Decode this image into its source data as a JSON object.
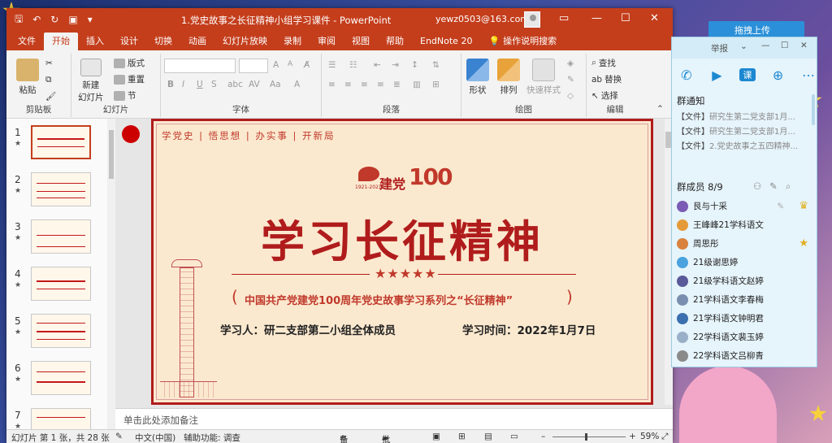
{
  "colors": {
    "ppt_accent": "#c43e1c",
    "slide_red": "#b01c1c",
    "qq_blue": "#1b88d1"
  },
  "window": {
    "title": "1.党史故事之长征精神小组学习课件  -  PowerPoint",
    "user": "yewz0503@163.com",
    "quick_access_icons": [
      "save-icon",
      "undo-icon",
      "redo-icon",
      "slideshow-icon",
      "customize-icon"
    ]
  },
  "tabs": [
    {
      "label": "文件"
    },
    {
      "label": "开始"
    },
    {
      "label": "插入"
    },
    {
      "label": "设计"
    },
    {
      "label": "切换"
    },
    {
      "label": "动画"
    },
    {
      "label": "幻灯片放映"
    },
    {
      "label": "录制"
    },
    {
      "label": "审阅"
    },
    {
      "label": "视图"
    },
    {
      "label": "帮助"
    },
    {
      "label": "EndNote 20"
    },
    {
      "label": "操作说明搜索"
    }
  ],
  "ribbon": {
    "clipboard": {
      "paste": "粘贴",
      "label": "剪贴板"
    },
    "slides": {
      "new_slide": "新建\n幻灯片",
      "layout": "版式",
      "reset": "重置",
      "section": "节",
      "label": "幻灯片"
    },
    "font": {
      "label": "字体",
      "bold": "B",
      "italic": "I",
      "underline": "U",
      "strike": "S",
      "grow": "A",
      "shrink": "A",
      "case": "Aa"
    },
    "paragraph": {
      "label": "段落"
    },
    "drawing": {
      "shapes": "形状",
      "arrange": "排列",
      "quick_styles": "快速样式",
      "label": "绘图"
    },
    "editing": {
      "find": "查找",
      "replace": "替换",
      "select": "选择",
      "label": "编辑"
    }
  },
  "thumbnails": [
    {
      "num": "1",
      "star": "★"
    },
    {
      "num": "2",
      "star": "★"
    },
    {
      "num": "3",
      "star": "★"
    },
    {
      "num": "4",
      "star": "★"
    },
    {
      "num": "5",
      "star": "★"
    },
    {
      "num": "6",
      "star": "★"
    },
    {
      "num": "7",
      "star": "★"
    }
  ],
  "slide": {
    "top_tagline": "学党史 | 悟思想 | 办实事 | 开新局",
    "logo_years": "1921-2021",
    "logo_text": "建党",
    "logo_100": "100",
    "title": "学习长征精神",
    "stars": "★★★★★",
    "subtitle": "中国共产党建党100周年党史故事学习系列之“长征精神”",
    "paren_left": "(",
    "paren_right": ")",
    "learner": "学习人：研二支部第二小组全体成员",
    "time": "学习时间：2022年1月7日"
  },
  "notes_placeholder": "单击此处添加备注",
  "status": {
    "slide_info": "幻灯片 第 1 张，共 28 张",
    "language": "中文(中国)",
    "accessibility": "辅助功能: 调查",
    "notes": "备注",
    "comments": "批注",
    "zoom": "59%"
  },
  "qq": {
    "upload": "拖拽上传",
    "top_label": "举报",
    "notice_title": "群通知",
    "files": [
      {
        "tag": "【文件】",
        "text": "研究生第二党支部1月..."
      },
      {
        "tag": "【文件】",
        "text": "研究生第二党支部1月..."
      },
      {
        "tag": "【文件】",
        "text": "2.党史故事之五四精神..."
      }
    ],
    "members_title": "群成员 8/9",
    "members": [
      {
        "name": "艮与十采",
        "color": "#7a5bb5",
        "badge": "crown"
      },
      {
        "name": "王峰峰21学科语文",
        "color": "#e59a3a",
        "badge": ""
      },
      {
        "name": "周思彤",
        "color": "#d9813e",
        "badge": "star"
      },
      {
        "name": "21级谢思婷",
        "color": "#4aa3df",
        "badge": ""
      },
      {
        "name": "21级学科语文赵婷",
        "color": "#5a5a9a",
        "badge": ""
      },
      {
        "name": "21学科语文李春梅",
        "color": "#7a8fb0",
        "badge": ""
      },
      {
        "name": "21学科语文钟明君",
        "color": "#3a6fb0",
        "badge": ""
      },
      {
        "name": "22学科语文裴玉婷",
        "color": "#9ab0c8",
        "badge": ""
      },
      {
        "name": "22学科语文吕柳青",
        "color": "#8a8a8a",
        "badge": ""
      }
    ]
  }
}
